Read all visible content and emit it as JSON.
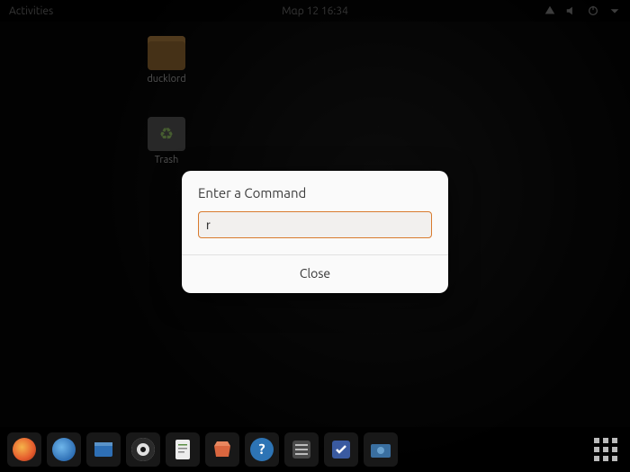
{
  "topbar": {
    "activities": "Activities",
    "clock": "Μαρ 12  16:34",
    "icons": [
      "network-icon",
      "volume-icon",
      "power-icon",
      "chevron-down-icon"
    ]
  },
  "desktop": {
    "home_folder": {
      "label": "ducklord"
    },
    "trash": {
      "label": "Trash"
    }
  },
  "dialog": {
    "title": "Enter a Command",
    "input_value": "r",
    "close_label": "Close"
  },
  "dock": {
    "items": [
      {
        "name": "firefox-icon",
        "color": "#e55b2d"
      },
      {
        "name": "thunderbird-icon",
        "color": "#2e6fb5"
      },
      {
        "name": "files-icon",
        "color": "#2e6fb5"
      },
      {
        "name": "rhythmbox-icon",
        "color": "#1d1d1d"
      },
      {
        "name": "writer-icon",
        "color": "#ececec"
      },
      {
        "name": "software-icon",
        "color": "#d9663f"
      },
      {
        "name": "help-icon",
        "color": "#2d74b5"
      },
      {
        "name": "settings-icon",
        "color": "#4a4a4a"
      },
      {
        "name": "todo-icon",
        "color": "#3a5aa0"
      },
      {
        "name": "screenshot-icon",
        "color": "#3a6fa0"
      }
    ],
    "apps_button": "show-applications"
  },
  "colors": {
    "dialog_bg": "#fafafa",
    "input_border": "#d97b2e"
  }
}
